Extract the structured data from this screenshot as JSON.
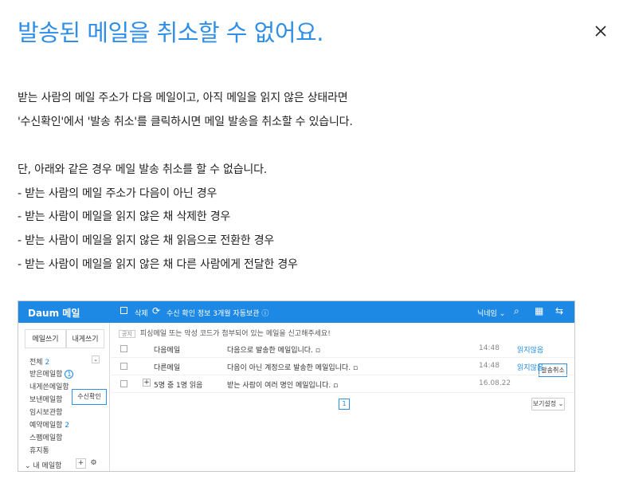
{
  "title": "발송된 메일을 취소할 수 없어요.",
  "close_icon": "close-icon",
  "paragraphs": {
    "p1": "받는 사람의 메일 주소가 다음 메일이고, 아직 메일을 읽지 않은 상태라면",
    "p2": "'수신확인'에서 '발송 취소'를 클릭하시면 메일 발송을 취소할 수 있습니다.",
    "p3": "단, 아래와 같은 경우 메일 발송 취소를 할 수 없습니다.",
    "p4": "- 받는 사람의 메일 주소가 다음이 아닌 경우",
    "p5": "- 받는 사람이 메일을 읽지 않은 채 삭제한 경우",
    "p6": "- 받는 사람이 메일을 읽지 않은 채 읽음으로 전환한 경우",
    "p7": "- 받는 사람이 메일을 읽지 않은 채 다른 사람에게 전달한 경우"
  },
  "shot": {
    "logo": "Daum 메일",
    "toolbar": {
      "delete": "삭제",
      "info": "수신 확인 정보 3개월 자동보관 ⓘ",
      "user": "닉네임 ⌄"
    },
    "side": {
      "write": "메일쓰기",
      "self": "내게쓰기",
      "all": "전체",
      "all_count": "2",
      "boxes": [
        "받은메일함",
        "내게쓴메일함",
        "보낸메일함",
        "임시보관함",
        "예약메일함",
        "스팸메일함",
        "휴지통"
      ],
      "inbox_badge": "1",
      "reserve_count": "2",
      "my_box": "⌄ 내 메일함",
      "check_button": "수신확인"
    },
    "notice_tag": "공지",
    "notice": "피싱메일 또는 악성 코드가 첨부되어 있는 메일을 신고해주세요!",
    "rows": [
      {
        "to": "다음메일",
        "subject": "다음으로 발송한 메일입니다.",
        "time": "14:48",
        "status": "읽지않음",
        "action": "발송취소"
      },
      {
        "to": "다른메일",
        "subject": "다음이 아닌 계정으로 발송한 메일입니다.",
        "time": "14:48",
        "status": "읽지않음",
        "action": ""
      },
      {
        "to": "5명 중 1명 읽음",
        "subject": "받는 사람이 여러 명인 메일입니다.",
        "time": "16.08.22",
        "status": "",
        "action": ""
      }
    ],
    "page": "1",
    "view_setting": "보기설정 ⌄"
  }
}
